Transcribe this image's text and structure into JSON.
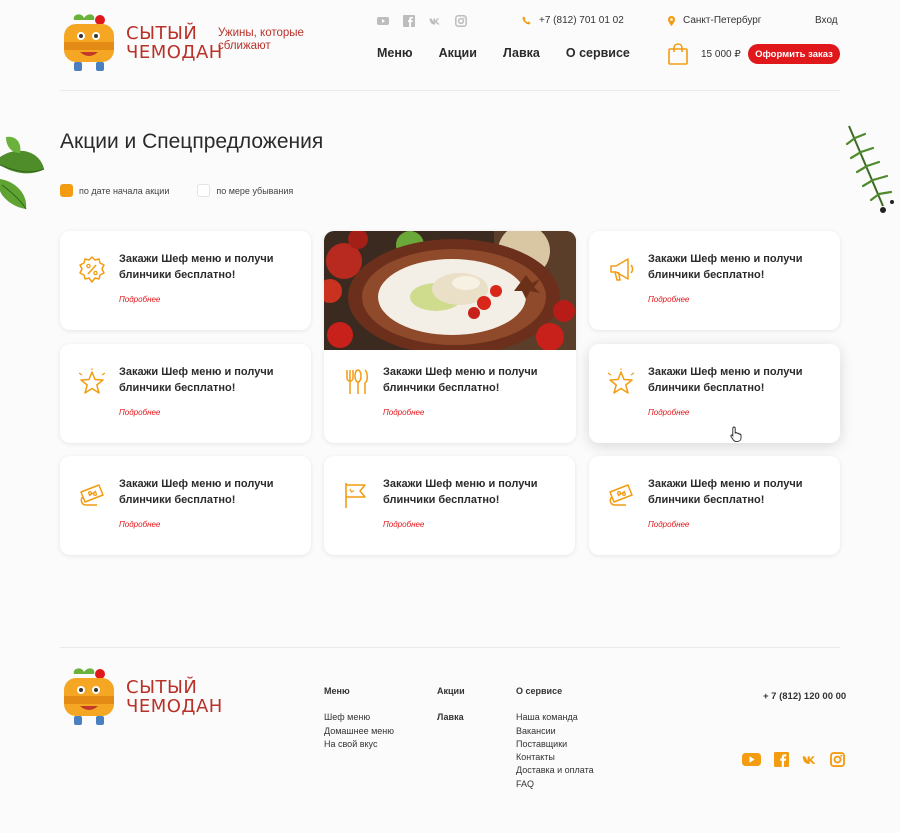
{
  "brand": {
    "name_line1": "СЫТЫЙ",
    "name_line2": "ЧЕМОДАН",
    "tagline": "Ужины, которые сближают"
  },
  "header": {
    "social_icons": [
      "youtube-icon",
      "facebook-icon",
      "vk-icon",
      "instagram-icon"
    ],
    "phone": "+7 (812) 701 01 02",
    "city": "Санкт-Петербург",
    "login": "Вход",
    "nav": [
      "Меню",
      "Акции",
      "Лавка",
      "О сервисе"
    ],
    "cart_sum": "15 000 ₽",
    "order_button": "Оформить заказ"
  },
  "page": {
    "title": "Акции и Спецпредложения",
    "filters": [
      {
        "label": "по дате начала акции",
        "checked": true
      },
      {
        "label": "по мере убывания",
        "checked": false
      }
    ]
  },
  "promos": [
    {
      "icon": "discount-badge-icon",
      "title": "Закажи Шеф меню и получи блинчики бесплатно!",
      "link": "Подробнее"
    },
    {
      "icon": "photo-dish",
      "title": "Закажи Шеф меню и получи блинчики бесплатно!",
      "link": "Подробнее"
    },
    {
      "icon": "megaphone-icon",
      "title": "Закажи Шеф меню и получи блинчики бесплатно!",
      "link": "Подробнее"
    },
    {
      "icon": "star-icon",
      "title": "Закажи Шеф меню и получи блинчики бесплатно!",
      "link": "Подробнее"
    },
    {
      "icon": "star-icon",
      "title": "Закажи Шеф меню и получи блинчики бесплатно!",
      "link": "Подробнее"
    },
    {
      "icon": "coupon-icon",
      "title": "Закажи Шеф меню и получи блинчики бесплатно!",
      "link": "Подробнее"
    },
    {
      "icon": "flag-icon",
      "title": "Закажи Шеф меню и получи блинчики бесплатно!",
      "link": "Подробнее"
    },
    {
      "icon": "coupon-icon",
      "title": "Закажи Шеф меню и получи блинчики бесплатно!",
      "link": "Подробнее"
    }
  ],
  "footer": {
    "menu_head": "Меню",
    "menu_items": [
      "Шеф меню",
      "Домашнее меню",
      "На свой вкус"
    ],
    "promo_head": "Акции",
    "shop_head": "Лавка",
    "about_head": "О сервисе",
    "about_items": [
      "Наша команда",
      "Вакансии",
      "Поставщики",
      "Контакты",
      "Доставка и оплата",
      "FAQ"
    ],
    "phone": "+ 7 (812) 120 00 00",
    "social_icons": [
      "youtube-icon",
      "facebook-icon",
      "vk-icon",
      "instagram-icon"
    ]
  },
  "colors": {
    "accent_orange": "#f39c12",
    "accent_red": "#e0171b",
    "brand_red": "#b8322a"
  }
}
